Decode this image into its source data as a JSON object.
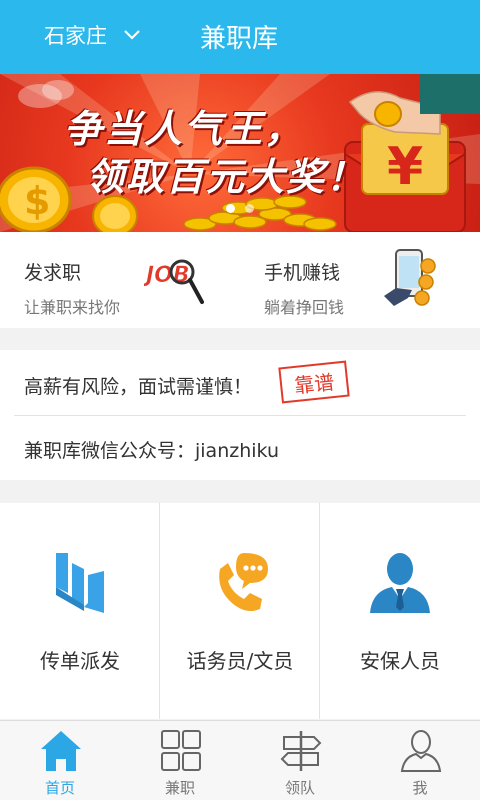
{
  "header": {
    "city": "石家庄",
    "title": "兼职库"
  },
  "banner": {
    "line1": "争当人气王，",
    "line2": "领取百元大奖！",
    "envelope_glyph": "¥",
    "coin_glyph": "$"
  },
  "quick_entries": [
    {
      "title": "发求职",
      "subtitle": "让兼职来找你",
      "icon": "job-magnifier-icon",
      "icon_text": "JOB"
    },
    {
      "title": "手机赚钱",
      "subtitle": "躺着挣回钱",
      "icon": "phone-money-icon"
    }
  ],
  "notices": {
    "warning": "高薪有风险，面试需谨慎！",
    "stamp": "靠谱",
    "wechat": "兼职库微信公众号：jianzhiku"
  },
  "categories": [
    {
      "label": "传单派发",
      "icon": "flyer-icon"
    },
    {
      "label": "话务员/文员",
      "icon": "phone-call-icon"
    },
    {
      "label": "安保人员",
      "icon": "security-person-icon"
    }
  ],
  "tabbar": {
    "items": [
      {
        "label": "首页",
        "icon": "home-icon",
        "active": true
      },
      {
        "label": "兼职",
        "icon": "grid-icon"
      },
      {
        "label": "领队",
        "icon": "signpost-icon"
      },
      {
        "label": "我",
        "icon": "user-icon"
      }
    ]
  },
  "colors": {
    "header": "#2bb8ed",
    "accent_active": "#2aa7e4",
    "banner_red": "#e8391f",
    "stamp_red": "#e23a2a",
    "icon_blue": "#3aa3e8",
    "icon_orange": "#f5a623"
  }
}
